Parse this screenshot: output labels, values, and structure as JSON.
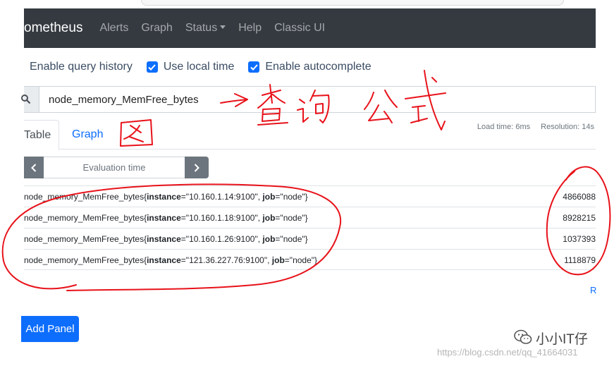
{
  "navbar": {
    "brand": "ometheus",
    "links": [
      "Alerts",
      "Graph",
      "Status",
      "Help",
      "Classic UI"
    ]
  },
  "options": {
    "query_history": "Enable query history",
    "local_time": "Use local time",
    "autocomplete": "Enable autocomplete",
    "local_time_checked": true,
    "autocomplete_checked": true
  },
  "query": {
    "expression": "node_memory_MemFree_bytes"
  },
  "tabs": {
    "table": "Table",
    "graph": "Graph",
    "active": "Table"
  },
  "stats": {
    "load_time": "Load time: 6ms",
    "resolution": "Resolution: 14s"
  },
  "eval": {
    "placeholder": "Evaluation time"
  },
  "results": [
    {
      "metric": "node_memory_MemFree_bytes",
      "instance": "10.160.1.14:9100",
      "job": "node",
      "value": "4866088"
    },
    {
      "metric": "node_memory_MemFree_bytes",
      "instance": "10.160.1.18:9100",
      "job": "node",
      "value": "8928215"
    },
    {
      "metric": "node_memory_MemFree_bytes",
      "instance": "10.160.1.26:9100",
      "job": "node",
      "value": "1037393"
    },
    {
      "metric": "node_memory_MemFree_bytes",
      "instance": "121.36.227.76:9100",
      "job": "node",
      "value": "1118879"
    }
  ],
  "remove_link": "R",
  "add_panel": "Add Panel",
  "watermark": {
    "name": "小小IT仔",
    "url": "https://blog.csdn.net/qq_41664031"
  },
  "annotations": {
    "arrow_text": "查询公式",
    "note_char": "图"
  },
  "colors": {
    "navbar_bg": "#343a40",
    "primary": "#0d6efd",
    "secondary": "#6c757d",
    "annotation_red": "#e8121a"
  }
}
